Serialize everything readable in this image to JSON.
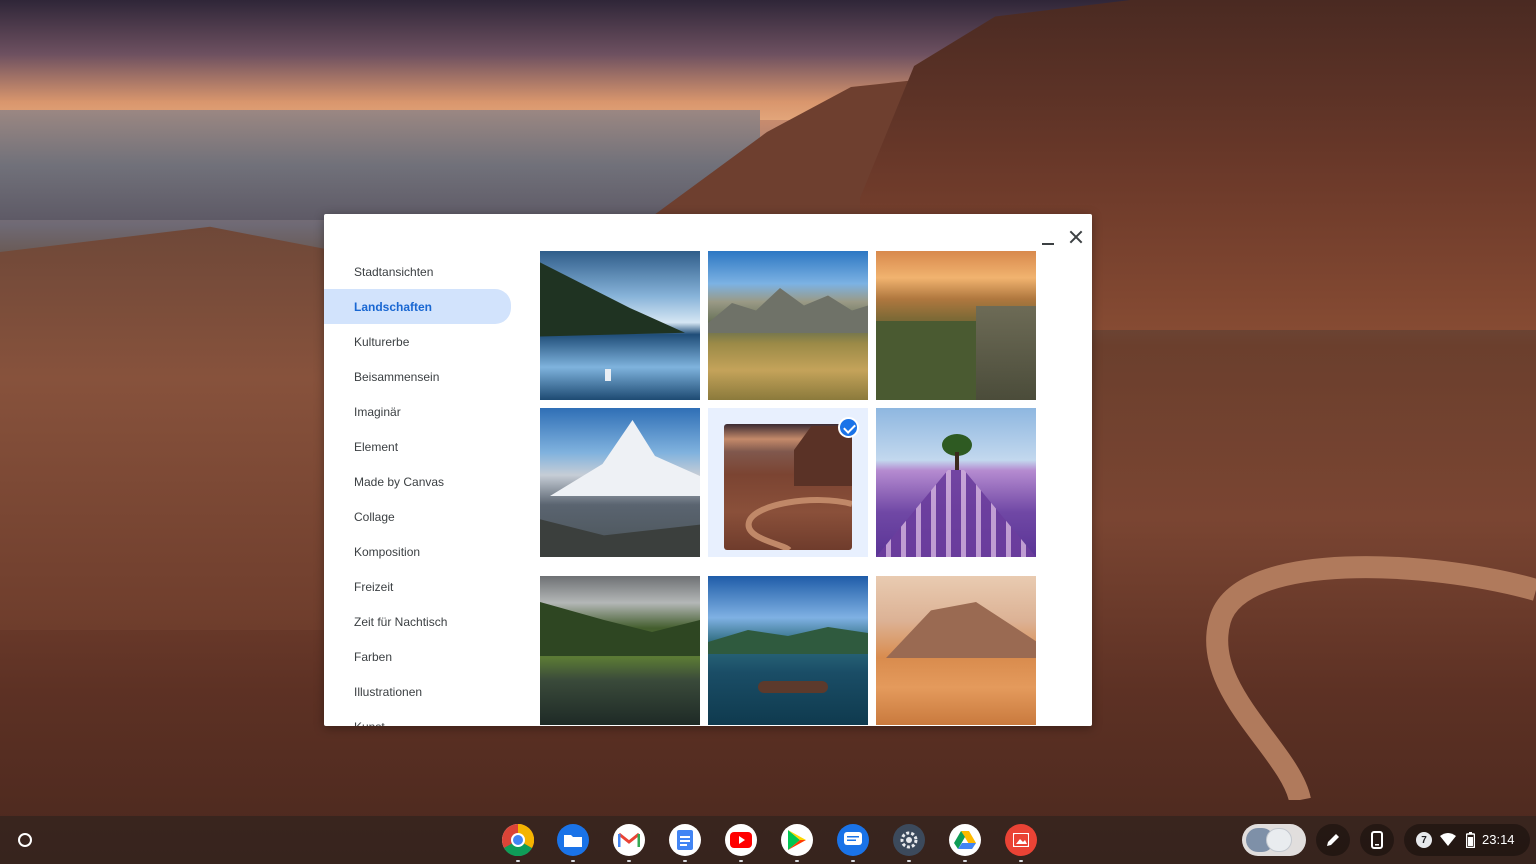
{
  "picker": {
    "categories": [
      {
        "label": "Stadtansichten"
      },
      {
        "label": "Landschaften"
      },
      {
        "label": "Kulturerbe"
      },
      {
        "label": "Beisammensein"
      },
      {
        "label": "Imaginär"
      },
      {
        "label": "Element"
      },
      {
        "label": "Made by Canvas"
      },
      {
        "label": "Collage"
      },
      {
        "label": "Komposition"
      },
      {
        "label": "Freizeit"
      },
      {
        "label": "Zeit für Nachtisch"
      },
      {
        "label": "Farben"
      },
      {
        "label": "Illustrationen"
      },
      {
        "label": "Kunst"
      }
    ],
    "active_category": "Landschaften",
    "wallpapers": [
      {
        "subject": "lake-with-sailboat"
      },
      {
        "subject": "mountain-meadow"
      },
      {
        "subject": "canyon-cliffs-sunset"
      },
      {
        "subject": "snowy-mountain-peak"
      },
      {
        "subject": "winding-road-canyon",
        "selected": true
      },
      {
        "subject": "lavender-field-with-tree"
      },
      {
        "subject": "mountain-lake-village"
      },
      {
        "subject": "lake-with-boats"
      },
      {
        "subject": "desert-dunes-mesa"
      }
    ]
  },
  "shelf": {
    "apps": [
      {
        "icon": "chrome-icon"
      },
      {
        "icon": "files-icon"
      },
      {
        "icon": "gmail-icon"
      },
      {
        "icon": "docs-icon"
      },
      {
        "icon": "youtube-icon"
      },
      {
        "icon": "play-store-icon"
      },
      {
        "icon": "messages-icon"
      },
      {
        "icon": "settings-icon"
      },
      {
        "icon": "drive-icon"
      },
      {
        "icon": "gallery-icon"
      }
    ],
    "tray": {
      "notification_count": "7",
      "clock": "23:14"
    }
  }
}
